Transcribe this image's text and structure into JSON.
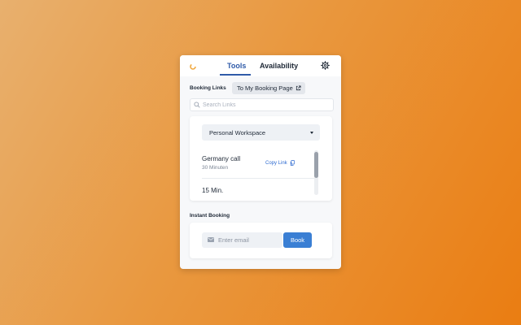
{
  "header": {
    "logo_icon": "spinner-logo-icon",
    "tabs": [
      {
        "label": "Tools",
        "active": true
      },
      {
        "label": "Availability",
        "active": false
      }
    ],
    "settings_icon": "gear-icon"
  },
  "booking_links": {
    "label": "Booking Links",
    "page_button_label": "To My Booking Page",
    "page_button_icon": "external-link-icon"
  },
  "search": {
    "placeholder": "Search Links",
    "icon": "search-icon"
  },
  "workspace": {
    "selected": "Personal Workspace"
  },
  "links": [
    {
      "title": "Germany call",
      "subtitle": "30 Minuten",
      "action_label": "Copy Link"
    },
    {
      "title": "15 Min."
    }
  ],
  "instant_booking": {
    "label": "Instant Booking",
    "email_placeholder": "Enter email",
    "button_label": "Book",
    "email_icon": "mail-icon"
  },
  "colors": {
    "accent": "#2e5aa8",
    "button": "#3a7fd4",
    "link": "#2e6bd1",
    "background_start": "#e8b06e",
    "background_end": "#ea7d12"
  }
}
